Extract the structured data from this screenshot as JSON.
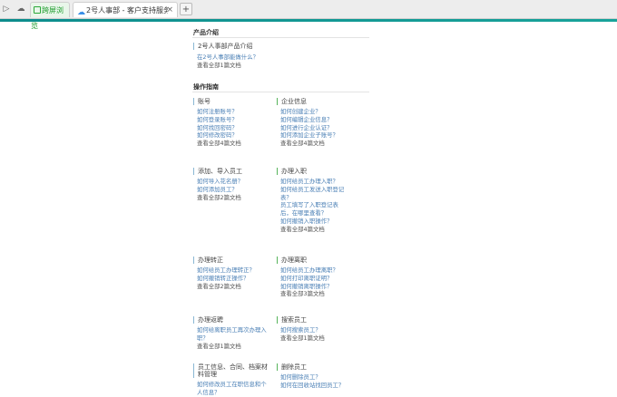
{
  "browser": {
    "tabs": [
      {
        "label": "跨屏浏览"
      },
      {
        "label": "2号人事部 - 客户支持服务平台"
      }
    ],
    "new_tab": "+"
  },
  "page": {
    "intro_section": {
      "title": "产品介绍",
      "category": "2号人事部产品介绍",
      "links": [
        "在2号人事部能做什么？"
      ],
      "more": "查看全部1篇文档"
    },
    "guide_section": {
      "title": "操作指南",
      "categories": [
        {
          "title": "账号",
          "links": [
            "如何注册账号？",
            "如何登录账号？",
            "如何找回密码？",
            "如何修改密码？"
          ],
          "more": "查看全部4篇文档"
        },
        {
          "title": "企业信息",
          "links": [
            "如何创建企业？",
            "如何编辑企业信息？",
            "如何进行企业认证？",
            "如何添加企业子账号？"
          ],
          "more": "查看全部4篇文档"
        },
        {
          "title": "添加、导入员工",
          "links": [
            "如何导入花名册？",
            "如何添加员工？"
          ],
          "more": "查看全部2篇文档"
        },
        {
          "title": "办理入职",
          "links": [
            "如何给员工办理入职？",
            "如何给员工发送入职登记表？",
            "员工填写了入职登记表后，在哪里查看？",
            "如何撤销入职操作？"
          ],
          "more": "查看全部4篇文档"
        },
        {
          "title": "办理转正",
          "links": [
            "如何给员工办理转正？",
            "如何撤销转正操作？"
          ],
          "more": "查看全部2篇文档"
        },
        {
          "title": "办理离职",
          "links": [
            "如何给员工办理离职？",
            "如何打印离职证明？",
            "如何撤销离职操作？"
          ],
          "more": "查看全部3篇文档"
        },
        {
          "title": "办理返聘",
          "links": [
            "如何给离职员工再次办理入职？"
          ],
          "more": "查看全部1篇文档"
        },
        {
          "title": "搜索员工",
          "links": [
            "如何搜索员工？"
          ],
          "more": "查看全部1篇文档"
        },
        {
          "title": "员工信息、合同、档案材料管理",
          "links": [
            "如何修改员工在职信息和个人信息？"
          ],
          "more": ""
        },
        {
          "title": "删除员工",
          "links": [
            "如何删除员工？",
            "如何在回收站找回员工？"
          ],
          "more": ""
        }
      ]
    }
  }
}
